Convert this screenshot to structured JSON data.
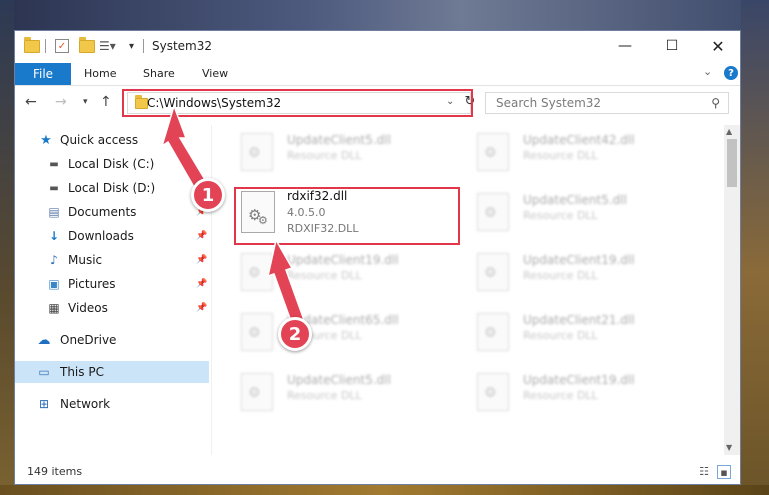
{
  "window": {
    "title": "System32"
  },
  "ribbon": {
    "file": "File",
    "home": "Home",
    "share": "Share",
    "view": "View"
  },
  "address": {
    "path": "C:\\Windows\\System32"
  },
  "search": {
    "placeholder": "Search System32"
  },
  "sidebar": {
    "items": [
      {
        "label": "Quick access",
        "icon": "star-icon"
      },
      {
        "label": "Local Disk (C:)",
        "icon": "drive-icon"
      },
      {
        "label": "Local Disk (D:)",
        "icon": "drive-icon"
      },
      {
        "label": "Documents",
        "icon": "documents-icon"
      },
      {
        "label": "Downloads",
        "icon": "download-icon"
      },
      {
        "label": "Music",
        "icon": "music-icon"
      },
      {
        "label": "Pictures",
        "icon": "pictures-icon"
      },
      {
        "label": "Videos",
        "icon": "videos-icon"
      },
      {
        "label": "OneDrive",
        "icon": "cloud-icon"
      },
      {
        "label": "This PC",
        "icon": "computer-icon"
      },
      {
        "label": "Network",
        "icon": "network-icon"
      }
    ]
  },
  "files": {
    "left": [
      {
        "name": "UpdateClient5.dll",
        "type": "Resource DLL"
      },
      {
        "name": "UpdateClient19.dll",
        "type": "Resource DLL"
      },
      {
        "name": "UpdateClient65.dll",
        "type": "Resource DLL"
      },
      {
        "name": "UpdateClient5.dll",
        "type": "Resource DLL"
      }
    ],
    "right": [
      {
        "name": "UpdateClient42.dll",
        "type": "Resource DLL"
      },
      {
        "name": "UpdateClient5.dll",
        "type": "Resource DLL"
      },
      {
        "name": "UpdateClient19.dll",
        "type": "Resource DLL"
      },
      {
        "name": "UpdateClient21.dll",
        "type": "Resource DLL"
      },
      {
        "name": "UpdateClient19.dll",
        "type": "Resource DLL"
      }
    ],
    "featured": {
      "name": "rdxif32.dll",
      "version": "4.0.5.0",
      "description": "RDXIF32.DLL"
    }
  },
  "status": {
    "count": "149 items"
  },
  "annotations": {
    "step1": "1",
    "step2": "2",
    "color": "#e2364a"
  }
}
